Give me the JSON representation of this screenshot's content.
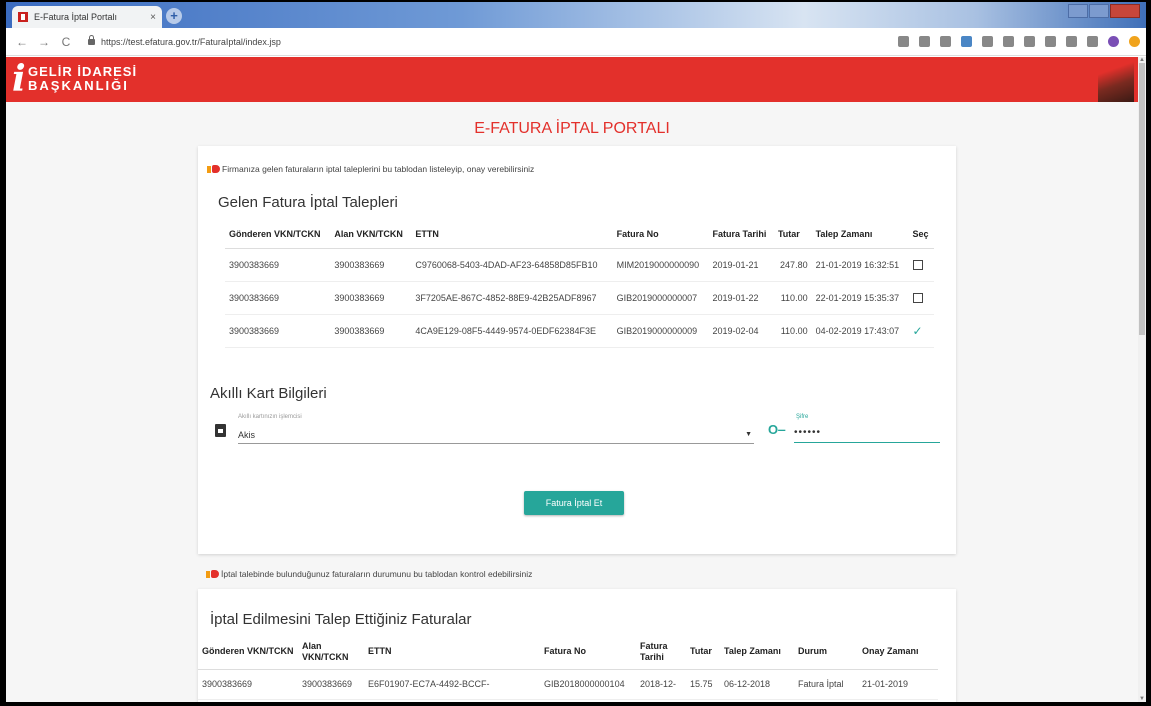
{
  "browser": {
    "tab_title": "E-Fatura İptal Portalı",
    "tab_close": "×",
    "new_tab": "+",
    "url": "https://test.efatura.gov.tr/FaturaIptal/index.jsp",
    "back": "←",
    "forward": "→",
    "reload": "C"
  },
  "header": {
    "logo_letter": "i",
    "logo_line1": "GELİR İDARESİ",
    "logo_line2": "BAŞKANLIĞI"
  },
  "page_title": "E-FATURA İPTAL PORTALI",
  "incoming": {
    "hint": "Firmanıza gelen faturaların iptal taleplerini bu tablodan listeleyip, onay verebilirsiniz",
    "title": "Gelen Fatura İptal Talepleri",
    "columns": [
      "Gönderen VKN/TCKN",
      "Alan VKN/TCKN",
      "ETTN",
      "Fatura No",
      "Fatura Tarihi",
      "Tutar",
      "Talep Zamanı",
      "Seç"
    ],
    "rows": [
      {
        "sender": "3900383669",
        "receiver": "3900383669",
        "ettn": "C9760068-5403-4DAD-AF23-64858D85FB10",
        "invoice_no": "MIM2019000000090",
        "date": "2019-01-21",
        "amount": "247.80",
        "request_time": "21-01-2019 16:32:51",
        "selected": false
      },
      {
        "sender": "3900383669",
        "receiver": "3900383669",
        "ettn": "3F7205AE-867C-4852-88E9-42B25ADF8967",
        "invoice_no": "GIB2019000000007",
        "date": "2019-01-22",
        "amount": "110.00",
        "request_time": "22-01-2019 15:35:37",
        "selected": false
      },
      {
        "sender": "3900383669",
        "receiver": "3900383669",
        "ettn": "4CA9E129-08F5-4449-9574-0EDF62384F3E",
        "invoice_no": "GIB2019000000009",
        "date": "2019-02-04",
        "amount": "110.00",
        "request_time": "04-02-2019 17:43:07",
        "selected": true
      }
    ]
  },
  "smart_card": {
    "title": "Akıllı Kart Bilgileri",
    "reader_label": "Akıllı kartınızın işlemcisi",
    "reader_value": "Akis",
    "password_label": "Şifre",
    "password_value": "••••••",
    "submit": "Fatura İptal Et"
  },
  "requested": {
    "hint": "İptal talebinde bulunduğunuz faturaların durumunu bu tablodan kontrol edebilirsiniz",
    "title": "İptal Edilmesini Talep Ettiğiniz Faturalar",
    "columns": [
      "Gönderen VKN/TCKN",
      "Alan VKN/TCKN",
      "ETTN",
      "Fatura No",
      "Fatura Tarihi",
      "Tutar",
      "Talep Zamanı",
      "Durum",
      "Onay Zamanı"
    ],
    "rows": [
      {
        "sender": "3900383669",
        "receiver": "3900383669",
        "ettn": "E6F01907-EC7A-4492-BCCF-",
        "invoice_no": "GIB2018000000104",
        "date": "2018-12-",
        "amount": "15.75",
        "request_time": "06-12-2018",
        "status": "Fatura İptal",
        "approval_time": "21-01-2019"
      }
    ]
  }
}
